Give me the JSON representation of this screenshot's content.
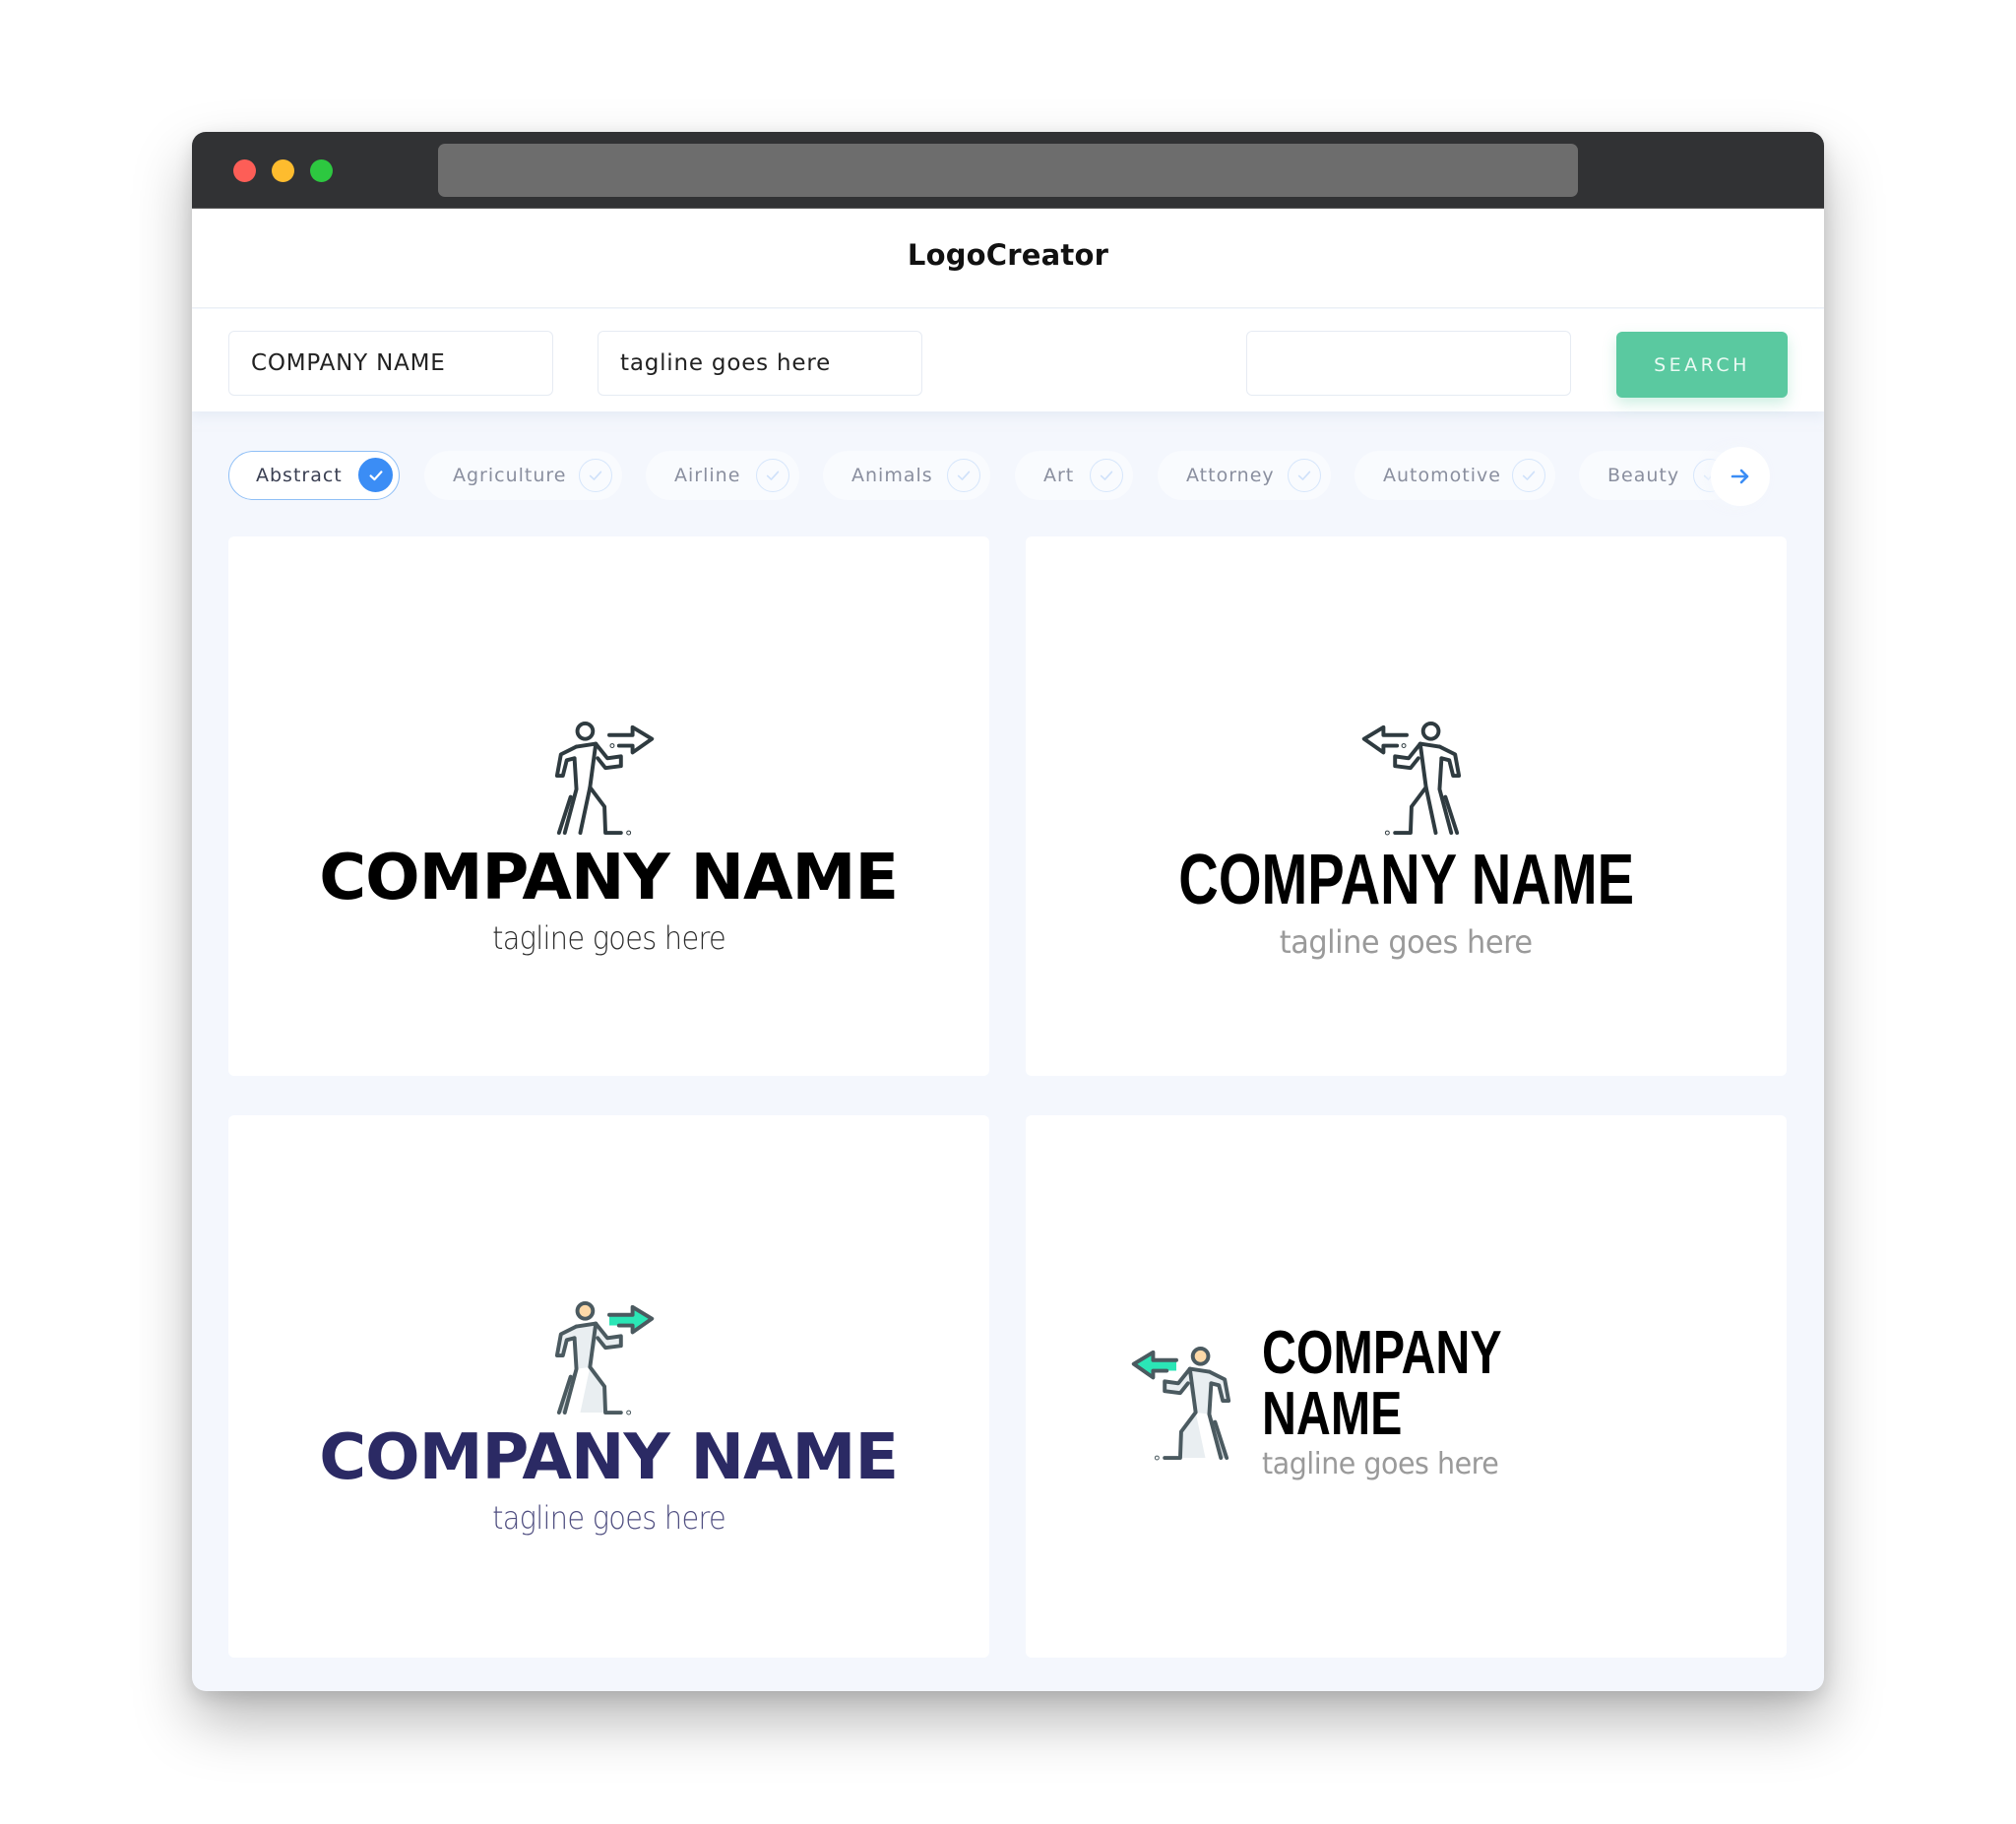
{
  "window": {
    "traffic_lights": [
      "close",
      "minimize",
      "maximize"
    ]
  },
  "header": {
    "title": "LogoCreator"
  },
  "search": {
    "company_name_value": "COMPANY NAME",
    "tagline_value": "tagline goes here",
    "keyword_value": "",
    "search_label": "SEARCH"
  },
  "categories": {
    "items": [
      {
        "label": "Abstract",
        "selected": true
      },
      {
        "label": "Agriculture",
        "selected": false
      },
      {
        "label": "Airline",
        "selected": false
      },
      {
        "label": "Animals",
        "selected": false
      },
      {
        "label": "Art",
        "selected": false
      },
      {
        "label": "Attorney",
        "selected": false
      },
      {
        "label": "Automotive",
        "selected": false
      },
      {
        "label": "Beauty",
        "selected": false
      }
    ],
    "next_icon": "arrow-right-icon"
  },
  "logos": [
    {
      "company": "COMPANY NAME",
      "tagline": "tagline goes here",
      "icon": "walking-person-arrow-right-outline",
      "layout": "stacked"
    },
    {
      "company": "COMPANY NAME",
      "tagline": "tagline goes here",
      "icon": "walking-person-arrow-left-outline",
      "layout": "stacked"
    },
    {
      "company": "COMPANY NAME",
      "tagline": "tagline goes here",
      "icon": "walking-person-arrow-right-color",
      "layout": "stacked"
    },
    {
      "company": "COMPANY NAME",
      "tagline": "tagline goes here",
      "icon": "walking-person-arrow-left-color",
      "layout": "inline"
    }
  ],
  "colors": {
    "accent_green": "#5ac9a0",
    "accent_blue": "#3b8df5",
    "navy": "#2b2a64",
    "teal_arrow": "#2be6b6",
    "icon_stroke": "#2f3b40"
  }
}
